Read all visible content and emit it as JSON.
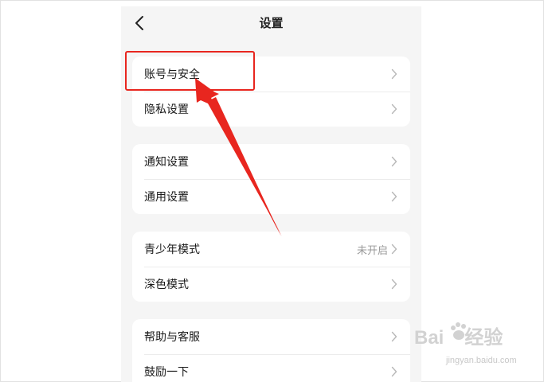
{
  "nav": {
    "title": "设置",
    "back_icon": "chevron-left-icon"
  },
  "groups": [
    {
      "items": [
        {
          "label": "账号与安全"
        },
        {
          "label": "隐私设置"
        }
      ]
    },
    {
      "items": [
        {
          "label": "通知设置"
        },
        {
          "label": "通用设置"
        }
      ]
    },
    {
      "items": [
        {
          "label": "青少年模式",
          "value": "未开启"
        },
        {
          "label": "深色模式"
        }
      ]
    },
    {
      "items": [
        {
          "label": "帮助与客服"
        },
        {
          "label": "鼓励一下"
        }
      ]
    }
  ],
  "annotation": {
    "highlight_color": "#e8261f",
    "target": "账号与安全"
  },
  "watermark": {
    "main_left": "Bai",
    "main_right": "经验",
    "sub": "jingyan.baidu.com"
  },
  "colors": {
    "page_bg": "#f5f5f5",
    "card_bg": "#ffffff",
    "chevron": "#b8b8b8"
  }
}
